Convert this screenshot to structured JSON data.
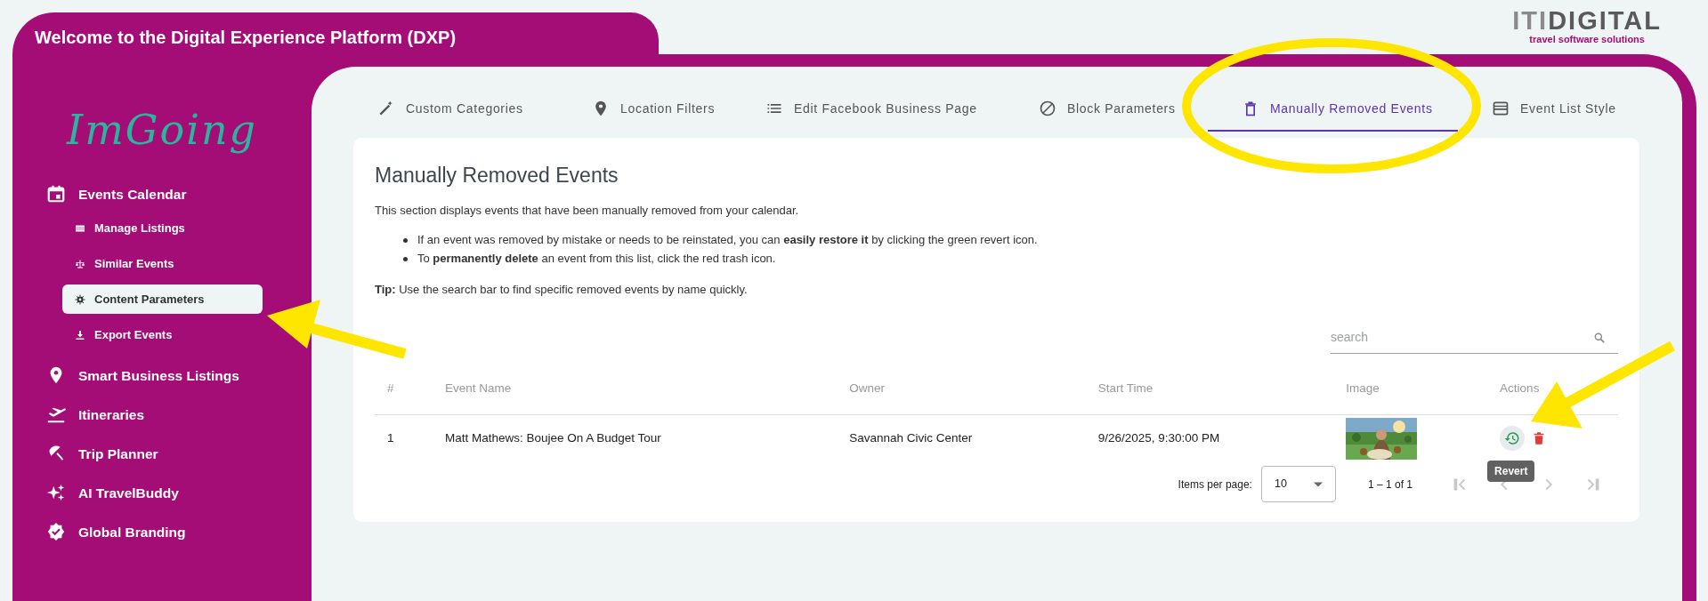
{
  "header": {
    "title": "Welcome to the Digital Experience Platform (DXP)"
  },
  "company_logo": {
    "prefix": "ITI",
    "word": "DIGITAL",
    "tagline": "travel software solutions"
  },
  "brand": "ImGoing",
  "sidebar": {
    "items": [
      {
        "label": "Events Calendar",
        "selected": false,
        "children": [
          {
            "label": "Manage Listings",
            "selected": false
          },
          {
            "label": "Similar Events",
            "selected": false
          },
          {
            "label": "Content Parameters",
            "selected": true
          },
          {
            "label": "Export Events",
            "selected": false
          }
        ]
      },
      {
        "label": "Smart Business Listings",
        "selected": false
      },
      {
        "label": "Itineraries",
        "selected": false
      },
      {
        "label": "Trip Planner",
        "selected": false
      },
      {
        "label": "AI TravelBuddy",
        "selected": false
      },
      {
        "label": "Global Branding",
        "selected": false
      }
    ]
  },
  "tabs": [
    {
      "label": "Custom Categories",
      "selected": false
    },
    {
      "label": "Location Filters",
      "selected": false
    },
    {
      "label": "Edit Facebook Business Page",
      "selected": false
    },
    {
      "label": "Block Parameters",
      "selected": false
    },
    {
      "label": "Manually Removed Events",
      "selected": true
    },
    {
      "label": "Event List Style",
      "selected": false
    }
  ],
  "panel": {
    "title": "Manually Removed Events",
    "intro": "This section displays events that have been manually removed from your calendar.",
    "bullets": [
      "If an event was removed by mistake or needs to be reinstated, you can **easily restore it** by clicking the green revert icon.",
      "To **permanently delete** an event from this list, click the red trash icon."
    ],
    "tip": "**Tip:** Use the search bar to find specific removed events by name quickly."
  },
  "search": {
    "placeholder": "search"
  },
  "table": {
    "columns": [
      "#",
      "Event Name",
      "Owner",
      "Start Time",
      "Image",
      "Actions"
    ],
    "rows": [
      {
        "cells": [
          "1",
          "Matt Mathews: Boujee On A Budget Tour",
          "Savannah Civic Center",
          "9/26/2025, 9:30:00 PM"
        ]
      }
    ]
  },
  "tooltip": "Revert",
  "pagination": {
    "label": "Items per page:",
    "page_size": "10",
    "range": "1 – 1 of 1",
    "buttons": [
      {
        "disabled": true
      },
      {
        "disabled": true
      },
      {
        "disabled": true
      },
      {
        "disabled": true
      }
    ]
  }
}
